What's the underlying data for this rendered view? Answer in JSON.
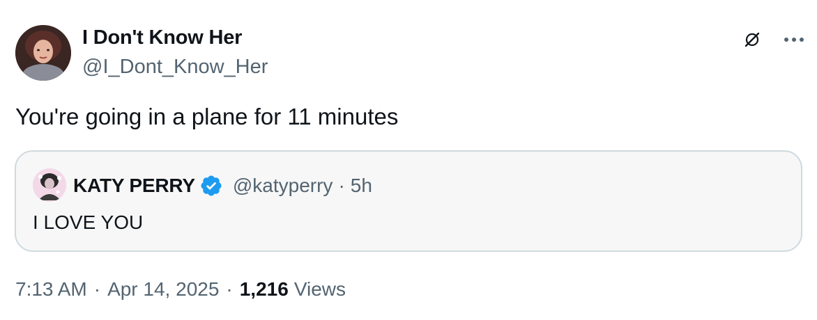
{
  "author": {
    "name": "I Don't Know Her",
    "handle": "@I_Dont_Know_Her"
  },
  "tweet": {
    "text": "You're going in a plane for 11 minutes"
  },
  "quoted_tweet": {
    "name": "KATY PERRY",
    "handle": "@katyperry",
    "separator": "·",
    "time": "5h",
    "text": "I LOVE YOU"
  },
  "meta": {
    "time": "7:13 AM",
    "separator": "·",
    "date": "Apr 14, 2025",
    "views_count": "1,216",
    "views_label": "Views"
  },
  "icons": {
    "top_right": [
      "grok-icon",
      "more-icon"
    ],
    "verified": "verified-badge-icon"
  },
  "colors": {
    "text": "#0f1419",
    "secondary": "#536471",
    "verified": "#1d9bf0",
    "quote_border": "#cfd9de",
    "quote_bg": "#f7f7f7"
  }
}
